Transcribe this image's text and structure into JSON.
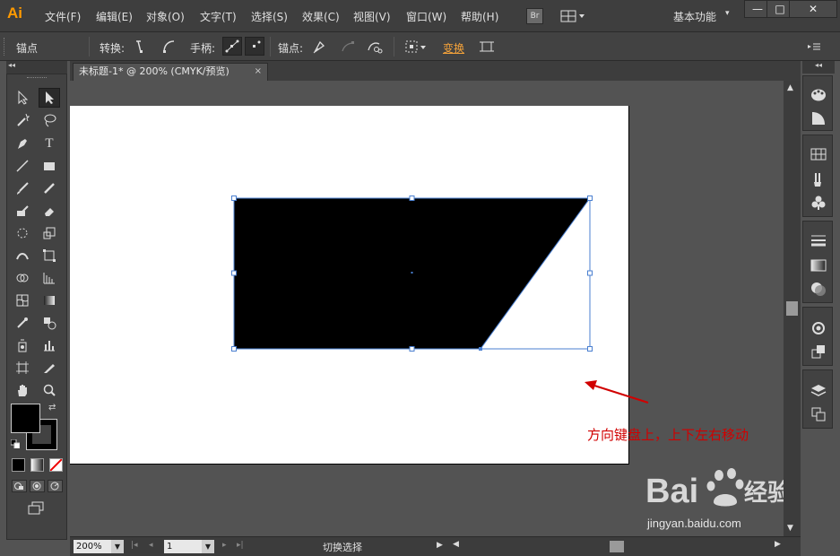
{
  "app": {
    "logo": "Ai",
    "workspace": "基本功能",
    "bridge_label": "Br"
  },
  "menu": [
    "文件(F)",
    "编辑(E)",
    "对象(O)",
    "文字(T)",
    "选择(S)",
    "效果(C)",
    "视图(V)",
    "窗口(W)",
    "帮助(H)"
  ],
  "window_controls": {
    "minimize": "—",
    "maximize": "□",
    "close": "✕"
  },
  "control_bar": {
    "mode_label": "锚点",
    "convert_label": "转换:",
    "handles_label": "手柄:",
    "anchors_label": "锚点:",
    "transform_label": "变换"
  },
  "document": {
    "tab_title": "未标题-1* @ 200% (CMYK/预览)",
    "tab_close": "×"
  },
  "status": {
    "zoom": "200%",
    "page": "1",
    "text": "切换选择"
  },
  "annotation": {
    "text": "方向键盘上，上下左右移动"
  },
  "watermark": {
    "brand": "Bai  经验",
    "url": "jingyan.baidu.com"
  },
  "colors": {
    "accent": "#ff9a00",
    "selection": "#4a7fd0",
    "annotation": "#d10000",
    "fill": "#000000",
    "stroke": "#ffffff"
  }
}
